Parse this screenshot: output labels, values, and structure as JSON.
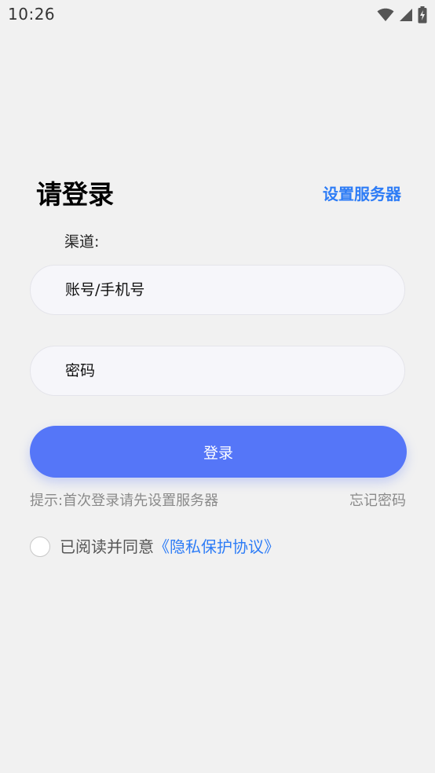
{
  "status_bar": {
    "time": "10:26",
    "icons": [
      "wifi-icon",
      "cellular-signal-icon",
      "battery-charging-icon"
    ]
  },
  "login": {
    "title": "请登录",
    "server_link": "设置服务器",
    "channel_label": "渠道:",
    "account_placeholder": "账号/手机号",
    "password_placeholder": "密码",
    "login_button": "登录",
    "hint": "提示:首次登录请先设置服务器",
    "forgot_password": "忘记密码",
    "agree_prefix": "已阅读并同意",
    "agreement_link": "《隐私保护协议》"
  },
  "colors": {
    "background": "#f1f1f1",
    "accent": "#2d7cf6",
    "button": "#5576f8",
    "hint_text": "#8a8a8a"
  }
}
